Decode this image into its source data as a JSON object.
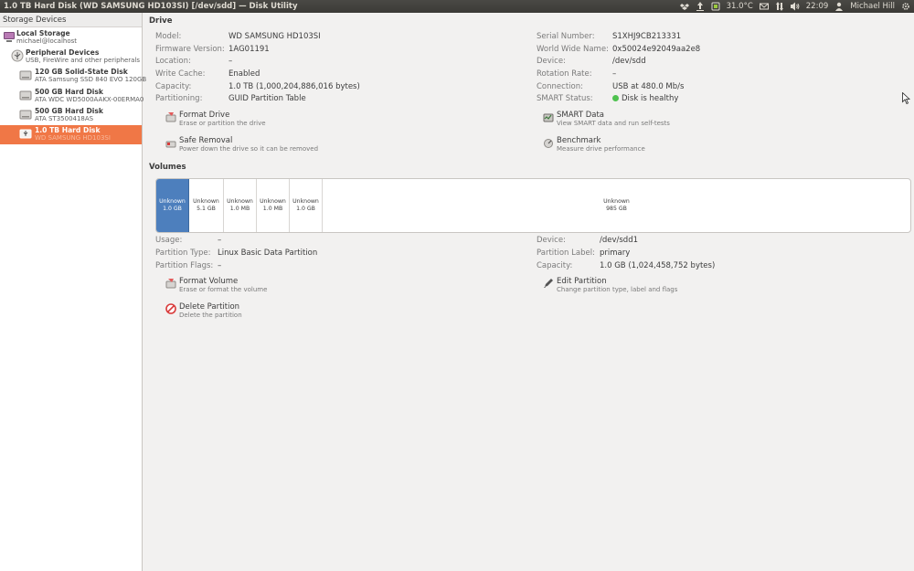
{
  "window": {
    "title": "1.0 TB Hard Disk (WD SAMSUNG HD103SI) [/dev/sdd] — Disk Utility"
  },
  "tray": {
    "temperature": "31.0°C",
    "time": "22:09",
    "user": "Michael Hill"
  },
  "sidebar": {
    "header": "Storage Devices",
    "items": [
      {
        "title": "Local Storage",
        "subtitle": "michael@localhost"
      },
      {
        "title": "Peripheral Devices",
        "subtitle": "USB, FireWire and other peripherals"
      },
      {
        "title": "120 GB Solid-State Disk",
        "subtitle": "ATA Samsung SSD 840 EVO 120GB"
      },
      {
        "title": "500 GB Hard Disk",
        "subtitle": "ATA WDC WD5000AAKX-00ERMA0"
      },
      {
        "title": "500 GB Hard Disk",
        "subtitle": "ATA ST3500418AS"
      },
      {
        "title": "1.0 TB Hard Disk",
        "subtitle": "WD SAMSUNG HD103SI"
      }
    ]
  },
  "drive": {
    "heading": "Drive",
    "left": [
      {
        "label": "Model:",
        "value": "WD SAMSUNG HD103SI"
      },
      {
        "label": "Firmware Version:",
        "value": "1AG01191"
      },
      {
        "label": "Location:",
        "value": "–"
      },
      {
        "label": "Write Cache:",
        "value": "Enabled"
      },
      {
        "label": "Capacity:",
        "value": "1.0 TB (1,000,204,886,016 bytes)"
      },
      {
        "label": "Partitioning:",
        "value": "GUID Partition Table"
      }
    ],
    "right": [
      {
        "label": "Serial Number:",
        "value": "S1XHJ9CB213331"
      },
      {
        "label": "World Wide Name:",
        "value": "0x50024e92049aa2e8"
      },
      {
        "label": "Device:",
        "value": "/dev/sdd"
      },
      {
        "label": "Rotation Rate:",
        "value": "–"
      },
      {
        "label": "Connection:",
        "value": "USB at 480.0 Mb/s"
      },
      {
        "label": "SMART Status:",
        "value": "Disk is healthy"
      }
    ],
    "actions": {
      "format": {
        "title": "Format Drive",
        "desc": "Erase or partition the drive"
      },
      "removal": {
        "title": "Safe Removal",
        "desc": "Power down the drive so it can be removed"
      },
      "smart": {
        "title": "SMART Data",
        "desc": "View SMART data and run self-tests"
      },
      "benchmark": {
        "title": "Benchmark",
        "desc": "Measure drive performance"
      }
    }
  },
  "volumes": {
    "heading": "Volumes",
    "segments": [
      {
        "name": "Unknown",
        "size": "1.0 GB"
      },
      {
        "name": "Unknown",
        "size": "5.1 GB"
      },
      {
        "name": "Unknown",
        "size": "1.0 MB"
      },
      {
        "name": "Unknown",
        "size": "1.0 MB"
      },
      {
        "name": "Unknown",
        "size": "1.0 GB"
      },
      {
        "name": "Unknown",
        "size": "985 GB"
      }
    ],
    "left": [
      {
        "label": "Usage:",
        "value": "–"
      },
      {
        "label": "Partition Type:",
        "value": "Linux Basic Data Partition"
      },
      {
        "label": "Partition Flags:",
        "value": "–"
      }
    ],
    "right": [
      {
        "label": "Device:",
        "value": "/dev/sdd1"
      },
      {
        "label": "Partition Label:",
        "value": "primary"
      },
      {
        "label": "Capacity:",
        "value": "1.0 GB (1,024,458,752 bytes)"
      }
    ],
    "actions": {
      "format": {
        "title": "Format Volume",
        "desc": "Erase or format the volume"
      },
      "edit": {
        "title": "Edit Partition",
        "desc": "Change partition type, label and flags"
      },
      "delete": {
        "title": "Delete Partition",
        "desc": "Delete the partition"
      }
    }
  }
}
